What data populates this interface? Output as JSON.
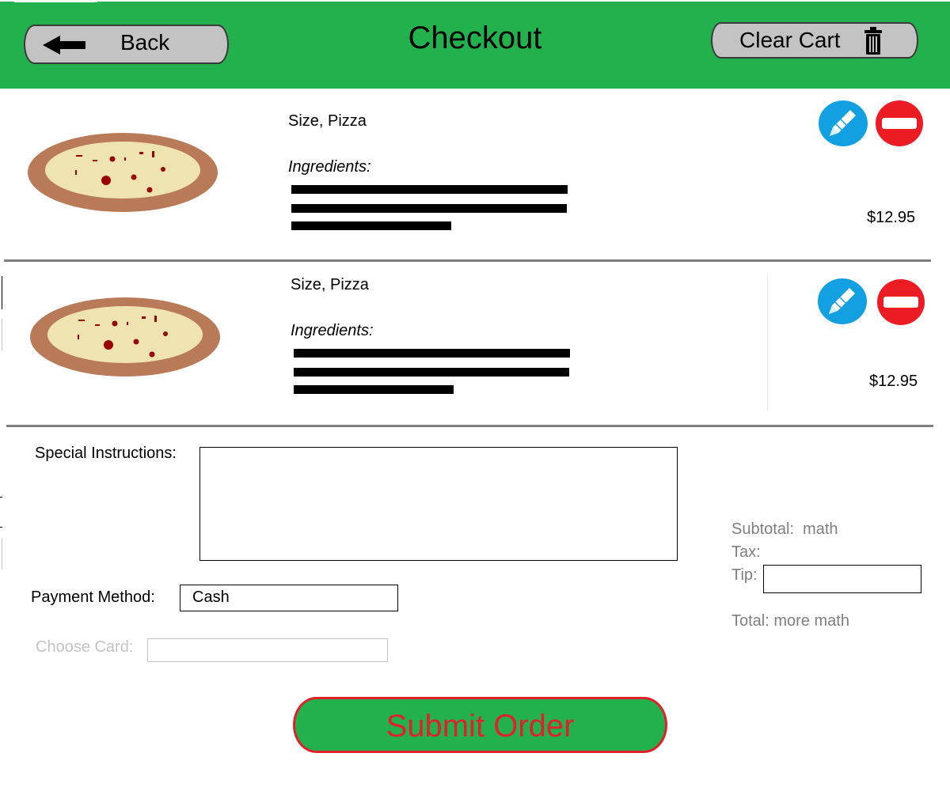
{
  "header": {
    "title": "Checkout",
    "back_label": "Back",
    "clear_label": "Clear Cart"
  },
  "cart": {
    "items": [
      {
        "title": "Size, Pizza",
        "ingredients_label": "Ingredients:",
        "price": "$12.95"
      },
      {
        "title": "Size, Pizza",
        "ingredients_label": "Ingredients:",
        "price": "$12.95"
      }
    ]
  },
  "form": {
    "special_instructions_label": "Special Instructions:",
    "special_instructions_value": "",
    "payment_method_label": "Payment Method:",
    "payment_method_value": "Cash",
    "choose_card_label": "Choose Card:",
    "choose_card_value": ""
  },
  "summary": {
    "subtotal": "Subtotal:  math",
    "tax": "Tax:",
    "tip_label": "Tip:",
    "tip_value": "",
    "total": "Total: more math"
  },
  "submit_label": "Submit Order",
  "icons": {
    "back": "arrow-left-icon",
    "clear": "trash-icon",
    "edit": "pencil-icon",
    "remove": "minus-icon"
  },
  "colors": {
    "header_green": "#22b14c",
    "edit_blue": "#13a0e3",
    "remove_red": "#ec1c24",
    "submit_text_red": "#e0202a",
    "button_grey": "#c3c3c3"
  }
}
